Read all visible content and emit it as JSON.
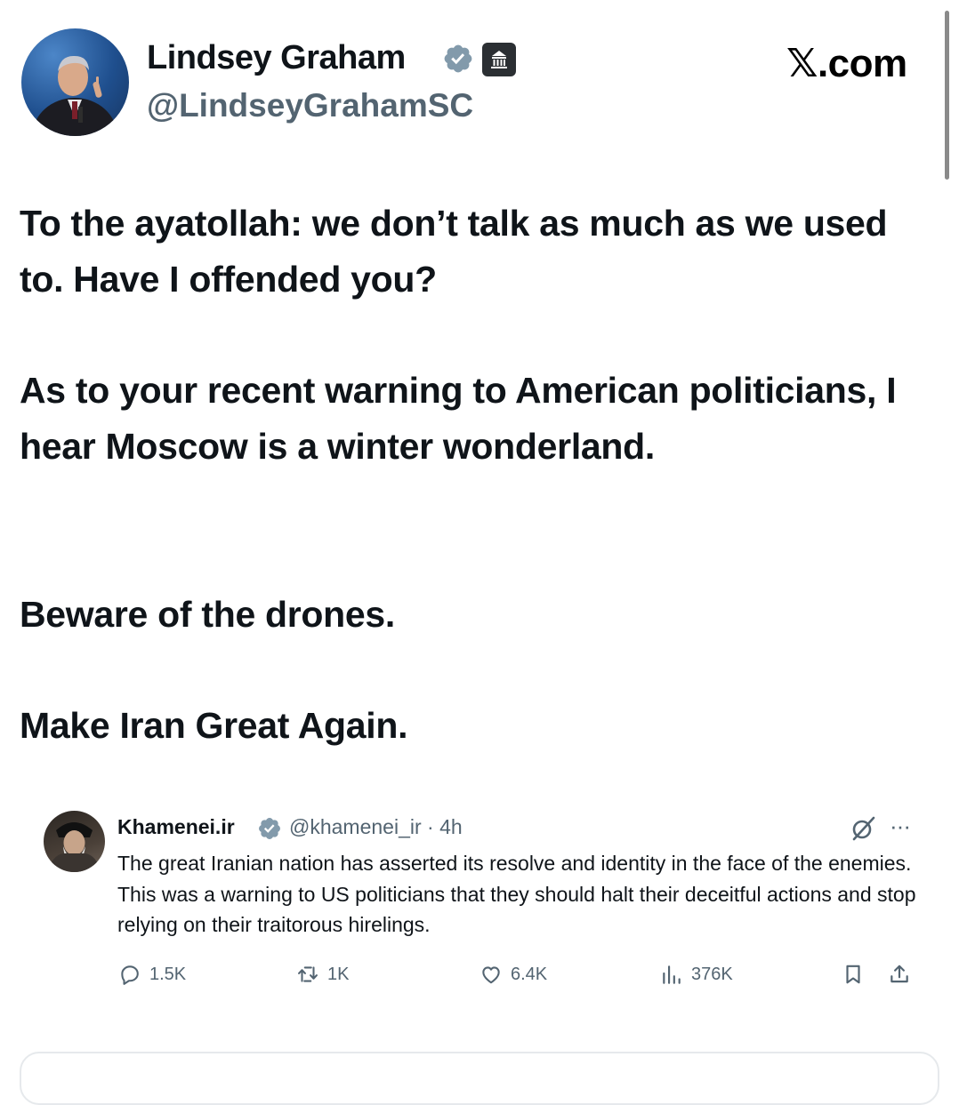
{
  "tweet": {
    "author": {
      "name": "Lindsey Graham",
      "handle": "@LindseyGrahamSC",
      "verified": true,
      "badge": "government-building-icon"
    },
    "site_label": "𝕏.com",
    "paragraphs": [
      "To the ayatollah: we don’t talk as much as we used to. Have I offended you?",
      "As to your recent warning to American politicians, I hear Moscow is a winter wonderland.",
      "Beware of the drones.",
      "Make Iran Great Again."
    ]
  },
  "quoted_tweet": {
    "name": "Khamenei.ir",
    "handle_time": "@khamenei_ir · 4h",
    "verified": true,
    "text": "The great Iranian nation has asserted its resolve and identity in the face of the enemies. This was a warning to US politicians that they should halt their deceitful actions and stop relying on their traitorous hirelings.",
    "actions": {
      "replies": "1.5K",
      "reposts": "1K",
      "likes": "6.4K",
      "views": "376K"
    }
  },
  "colors": {
    "text": "#0f1419",
    "secondary": "#536471",
    "verified_blue": "#1d9bf0",
    "badge_bg": "#2b2f33"
  }
}
